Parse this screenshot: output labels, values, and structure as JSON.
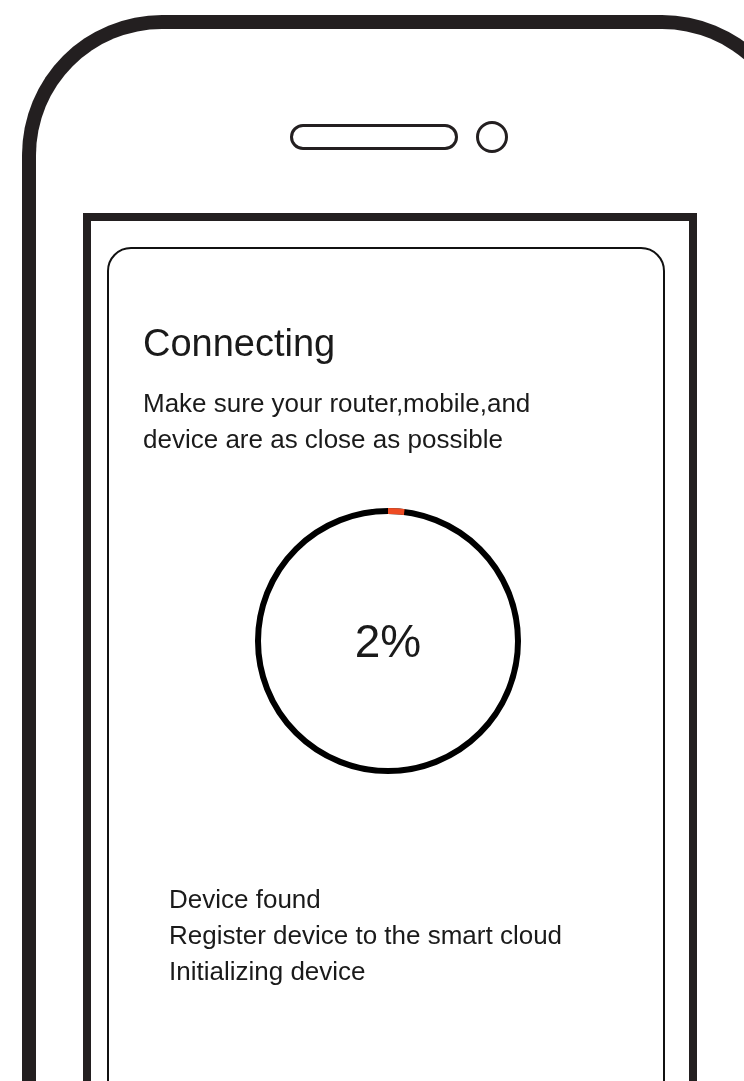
{
  "screen": {
    "title": "Connecting",
    "message": "Make sure your router,mobile,and device are as close as possible",
    "progress": {
      "level": 0.02,
      "label": "2%"
    },
    "steps": [
      "Device found",
      "Register device to the smart cloud",
      "Initializing device"
    ]
  }
}
